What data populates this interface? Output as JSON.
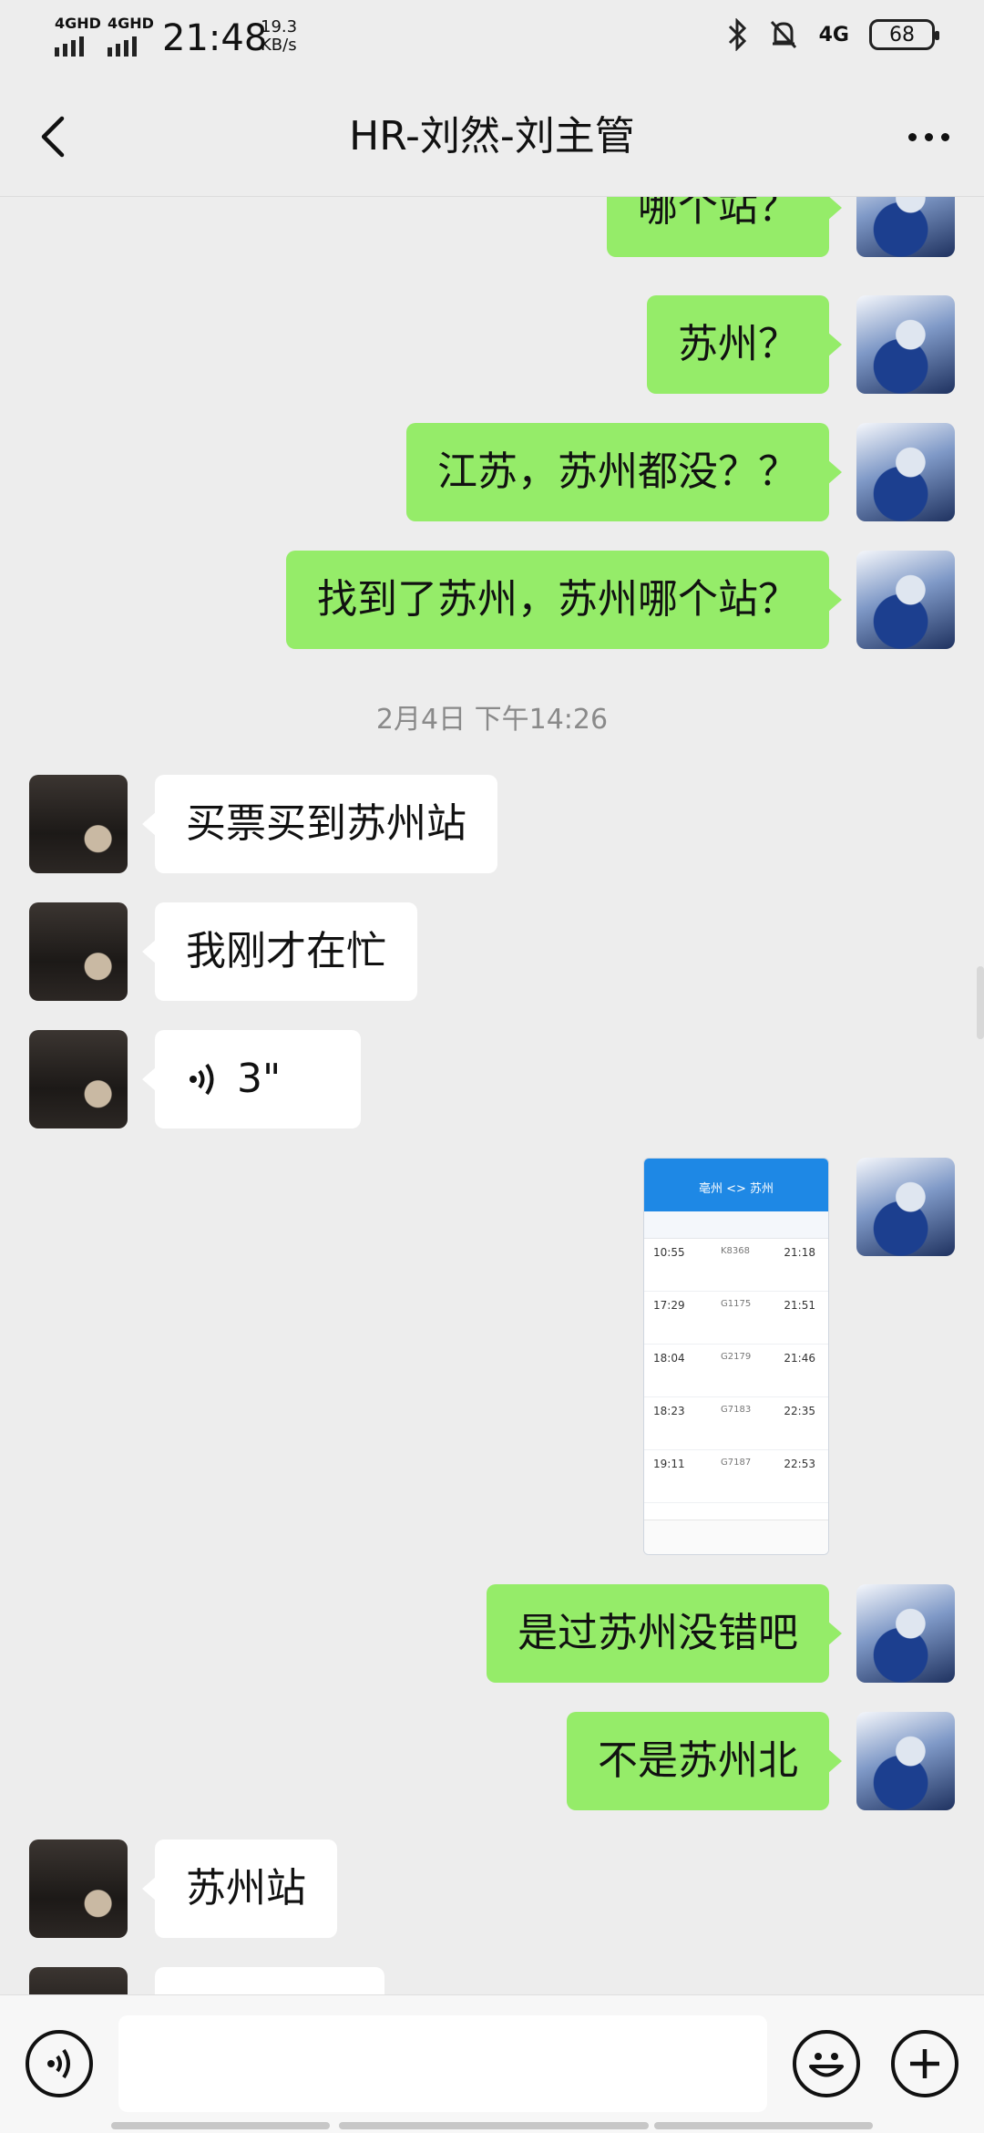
{
  "status_bar": {
    "sim1": "4GHD",
    "sim2": "4GHD",
    "time": "21:48",
    "speed_value": "19.3",
    "speed_unit": "KB/s",
    "network": "4G",
    "battery": "68"
  },
  "header": {
    "title": "HR-刘然-刘主管"
  },
  "messages": {
    "m1": "哪个站？",
    "m2": "苏州？",
    "m3": "江苏，苏州都没？？",
    "m4": "找到了苏州，苏州哪个站？",
    "timestamp": "2月4日 下午14:26",
    "o1": "买票买到苏州站",
    "o2": "我刚才在忙",
    "voice_duration": "3\"",
    "m5": "是过苏州没错吧",
    "m6": "不是苏州北",
    "o3": "苏州站"
  },
  "screenshot": {
    "title": "亳州 <> 苏州",
    "rows": [
      {
        "dep": "10:55",
        "train": "K8368",
        "arr": "21:18"
      },
      {
        "dep": "17:29",
        "train": "G1175",
        "arr": "21:51"
      },
      {
        "dep": "18:04",
        "train": "G2179",
        "arr": "21:46"
      },
      {
        "dep": "18:23",
        "train": "G7183",
        "arr": "22:35"
      },
      {
        "dep": "19:11",
        "train": "G7187",
        "arr": "22:53"
      }
    ]
  },
  "input": {
    "placeholder": ""
  },
  "colors": {
    "my_bubble": "#95ec69",
    "other_bubble": "#ffffff",
    "background": "#ededed"
  },
  "icons": {
    "back": "chevron-left-icon",
    "more": "more-dots-icon",
    "voice": "voice-icon",
    "emoji": "emoji-icon",
    "add": "plus-icon"
  }
}
